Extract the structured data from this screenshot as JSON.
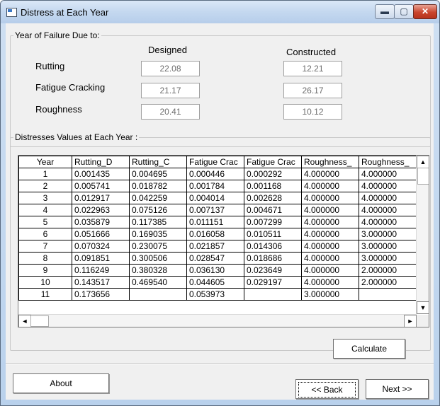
{
  "window": {
    "title": "Distress at Each Year"
  },
  "titlebar_buttons": {
    "minimize": "▬",
    "maximize": "▢",
    "close": "✕"
  },
  "failure": {
    "group_label": "Year of Failure Due to:",
    "designed_header": "Designed",
    "constructed_header": "Constructed",
    "rows": [
      {
        "label": "Rutting",
        "designed": "22.08",
        "constructed": "12.21"
      },
      {
        "label": "Fatigue Cracking",
        "designed": "21.17",
        "constructed": "26.17"
      },
      {
        "label": "Roughness",
        "designed": "20.41",
        "constructed": "10.12"
      }
    ]
  },
  "distress": {
    "group_label": "Distresses Values at Each Year :",
    "columns": [
      "Year",
      "Rutting_D",
      "Rutting_C",
      "Fatigue Crac",
      "Fatigue Crac",
      "Roughness_",
      "Roughness_"
    ],
    "rows": [
      [
        "1",
        "0.001435",
        "0.004695",
        "0.000446",
        "0.000292",
        "4.000000",
        "4.000000"
      ],
      [
        "2",
        "0.005741",
        "0.018782",
        "0.001784",
        "0.001168",
        "4.000000",
        "4.000000"
      ],
      [
        "3",
        "0.012917",
        "0.042259",
        "0.004014",
        "0.002628",
        "4.000000",
        "4.000000"
      ],
      [
        "4",
        "0.022963",
        "0.075126",
        "0.007137",
        "0.004671",
        "4.000000",
        "4.000000"
      ],
      [
        "5",
        "0.035879",
        "0.117385",
        "0.011151",
        "0.007299",
        "4.000000",
        "4.000000"
      ],
      [
        "6",
        "0.051666",
        "0.169035",
        "0.016058",
        "0.010511",
        "4.000000",
        "3.000000"
      ],
      [
        "7",
        "0.070324",
        "0.230075",
        "0.021857",
        "0.014306",
        "4.000000",
        "3.000000"
      ],
      [
        "8",
        "0.091851",
        "0.300506",
        "0.028547",
        "0.018686",
        "4.000000",
        "3.000000"
      ],
      [
        "9",
        "0.116249",
        "0.380328",
        "0.036130",
        "0.023649",
        "4.000000",
        "2.000000"
      ],
      [
        "10",
        "0.143517",
        "0.469540",
        "0.044605",
        "0.029197",
        "4.000000",
        "2.000000"
      ],
      [
        "11",
        "0.173656",
        "",
        "0.053973",
        "",
        "3.000000",
        ""
      ]
    ],
    "scroll_up": "▲",
    "scroll_down": "▼",
    "scroll_left": "◄",
    "scroll_right": "►"
  },
  "buttons": {
    "calculate": "Calculate",
    "about": "About",
    "back": "<< Back",
    "next": "Next >>"
  }
}
